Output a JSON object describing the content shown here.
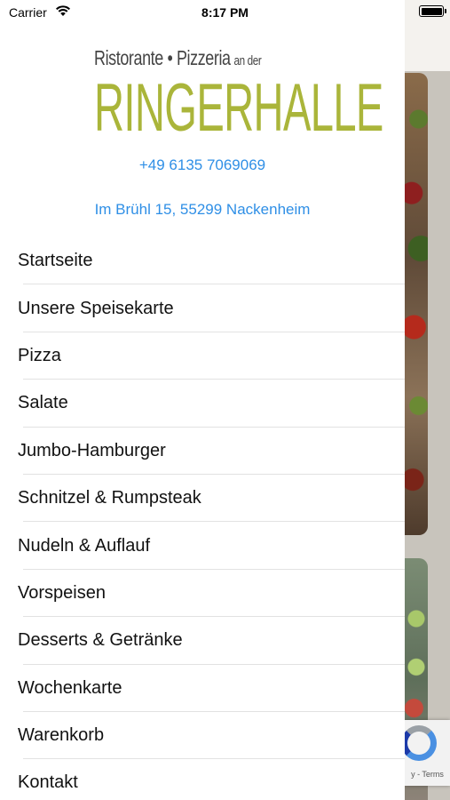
{
  "status_bar": {
    "carrier": "Carrier",
    "time": "8:17 PM"
  },
  "logo": {
    "line1": "Ristorante • Pizzeria",
    "line1_small": "an der",
    "line2": "RINGERHALLE"
  },
  "contact": {
    "phone": "+49 6135 7069069",
    "address": "Im Brühl 15, 55299 Nackenheim"
  },
  "menu": {
    "items": [
      {
        "label": "Startseite"
      },
      {
        "label": "Unsere Speisekarte"
      },
      {
        "label": "Pizza"
      },
      {
        "label": "Salate"
      },
      {
        "label": "Jumbo-Hamburger"
      },
      {
        "label": "Schnitzel & Rumpsteak"
      },
      {
        "label": "Nudeln & Auflauf"
      },
      {
        "label": "Vorspeisen"
      },
      {
        "label": "Desserts & Getränke"
      },
      {
        "label": "Wochenkarte"
      },
      {
        "label": "Warenkorb"
      },
      {
        "label": "Kontakt"
      }
    ]
  },
  "recaptcha": {
    "text": "y - Terms"
  },
  "colors": {
    "link": "#2f8fe6",
    "logo_green": "#aab53a",
    "logo_gray": "#444444"
  }
}
